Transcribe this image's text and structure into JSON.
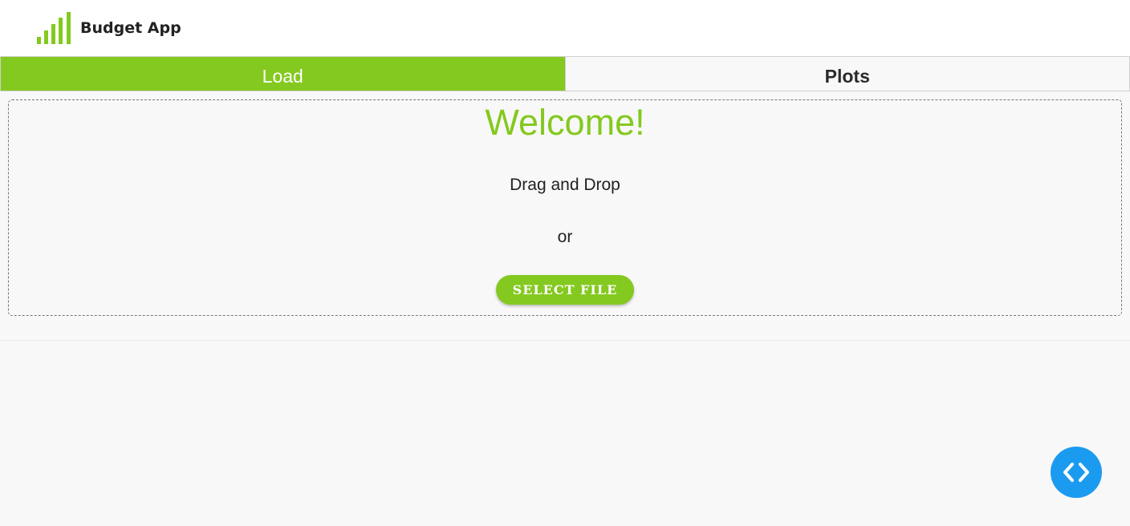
{
  "header": {
    "app_title": "Budget App",
    "logo_icon": "bar-chart-icon",
    "brand_color": "#84c91f"
  },
  "tabs": [
    {
      "label": "Load",
      "active": true
    },
    {
      "label": "Plots",
      "active": false
    }
  ],
  "dropzone": {
    "welcome": "Welcome!",
    "drag_text": "Drag and Drop",
    "or_text": "or",
    "select_button_label": "SELECT FILE"
  },
  "fab": {
    "icon": "code-icon",
    "color": "#1b9bf0"
  }
}
